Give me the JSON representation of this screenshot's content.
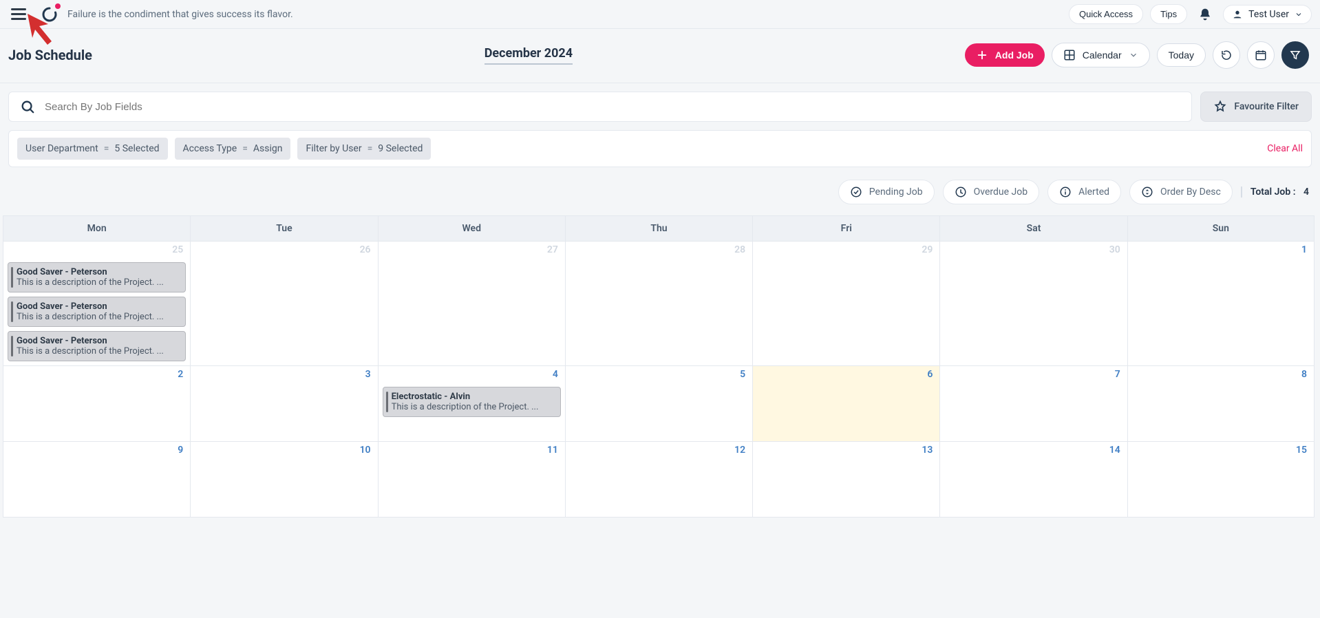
{
  "topbar": {
    "quote": "Failure is the condiment that gives success its flavor.",
    "quick_access": "Quick Access",
    "tips": "Tips",
    "user_name": "Test User"
  },
  "header": {
    "title": "Job Schedule",
    "period": "December 2024",
    "add_job": "Add Job",
    "calendar": "Calendar",
    "today": "Today"
  },
  "search": {
    "placeholder": "Search By Job Fields",
    "favourite_filter": "Favourite Filter"
  },
  "filters": {
    "clear_all": "Clear All",
    "chips": [
      {
        "label": "User Department",
        "op": "=",
        "value": "5 Selected"
      },
      {
        "label": "Access Type",
        "op": "=",
        "value": "Assign"
      },
      {
        "label": "Filter by User",
        "op": "=",
        "value": "9 Selected"
      }
    ]
  },
  "status": {
    "pending": "Pending Job",
    "overdue": "Overdue Job",
    "alerted": "Alerted",
    "order": "Order By Desc",
    "total_label": "Total Job :",
    "total_value": "4"
  },
  "calendar": {
    "days": [
      "Mon",
      "Tue",
      "Wed",
      "Thu",
      "Fri",
      "Sat",
      "Sun"
    ],
    "rows": [
      [
        {
          "n": "25",
          "prev": true,
          "today": false,
          "jobs": [
            {
              "title": "Good Saver - Peterson",
              "desc": "This is a description of the Project. ..."
            },
            {
              "title": "Good Saver - Peterson",
              "desc": "This is a description of the Project. ..."
            },
            {
              "title": "Good Saver - Peterson",
              "desc": "This is a description of the Project. ..."
            }
          ]
        },
        {
          "n": "26",
          "prev": true,
          "today": false,
          "jobs": []
        },
        {
          "n": "27",
          "prev": true,
          "today": false,
          "jobs": []
        },
        {
          "n": "28",
          "prev": true,
          "today": false,
          "jobs": []
        },
        {
          "n": "29",
          "prev": true,
          "today": false,
          "jobs": []
        },
        {
          "n": "30",
          "prev": true,
          "today": false,
          "jobs": []
        },
        {
          "n": "1",
          "prev": false,
          "today": false,
          "jobs": []
        }
      ],
      [
        {
          "n": "2",
          "prev": false,
          "today": false,
          "jobs": []
        },
        {
          "n": "3",
          "prev": false,
          "today": false,
          "jobs": []
        },
        {
          "n": "4",
          "prev": false,
          "today": false,
          "jobs": [
            {
              "title": "Electrostatic - Alvin",
              "desc": "This is a description of the Project. ..."
            }
          ]
        },
        {
          "n": "5",
          "prev": false,
          "today": false,
          "jobs": []
        },
        {
          "n": "6",
          "prev": false,
          "today": true,
          "jobs": []
        },
        {
          "n": "7",
          "prev": false,
          "today": false,
          "jobs": []
        },
        {
          "n": "8",
          "prev": false,
          "today": false,
          "jobs": []
        }
      ],
      [
        {
          "n": "9",
          "prev": false,
          "today": false,
          "jobs": []
        },
        {
          "n": "10",
          "prev": false,
          "today": false,
          "jobs": []
        },
        {
          "n": "11",
          "prev": false,
          "today": false,
          "jobs": []
        },
        {
          "n": "12",
          "prev": false,
          "today": false,
          "jobs": []
        },
        {
          "n": "13",
          "prev": false,
          "today": false,
          "jobs": []
        },
        {
          "n": "14",
          "prev": false,
          "today": false,
          "jobs": []
        },
        {
          "n": "15",
          "prev": false,
          "today": false,
          "jobs": []
        }
      ]
    ]
  }
}
